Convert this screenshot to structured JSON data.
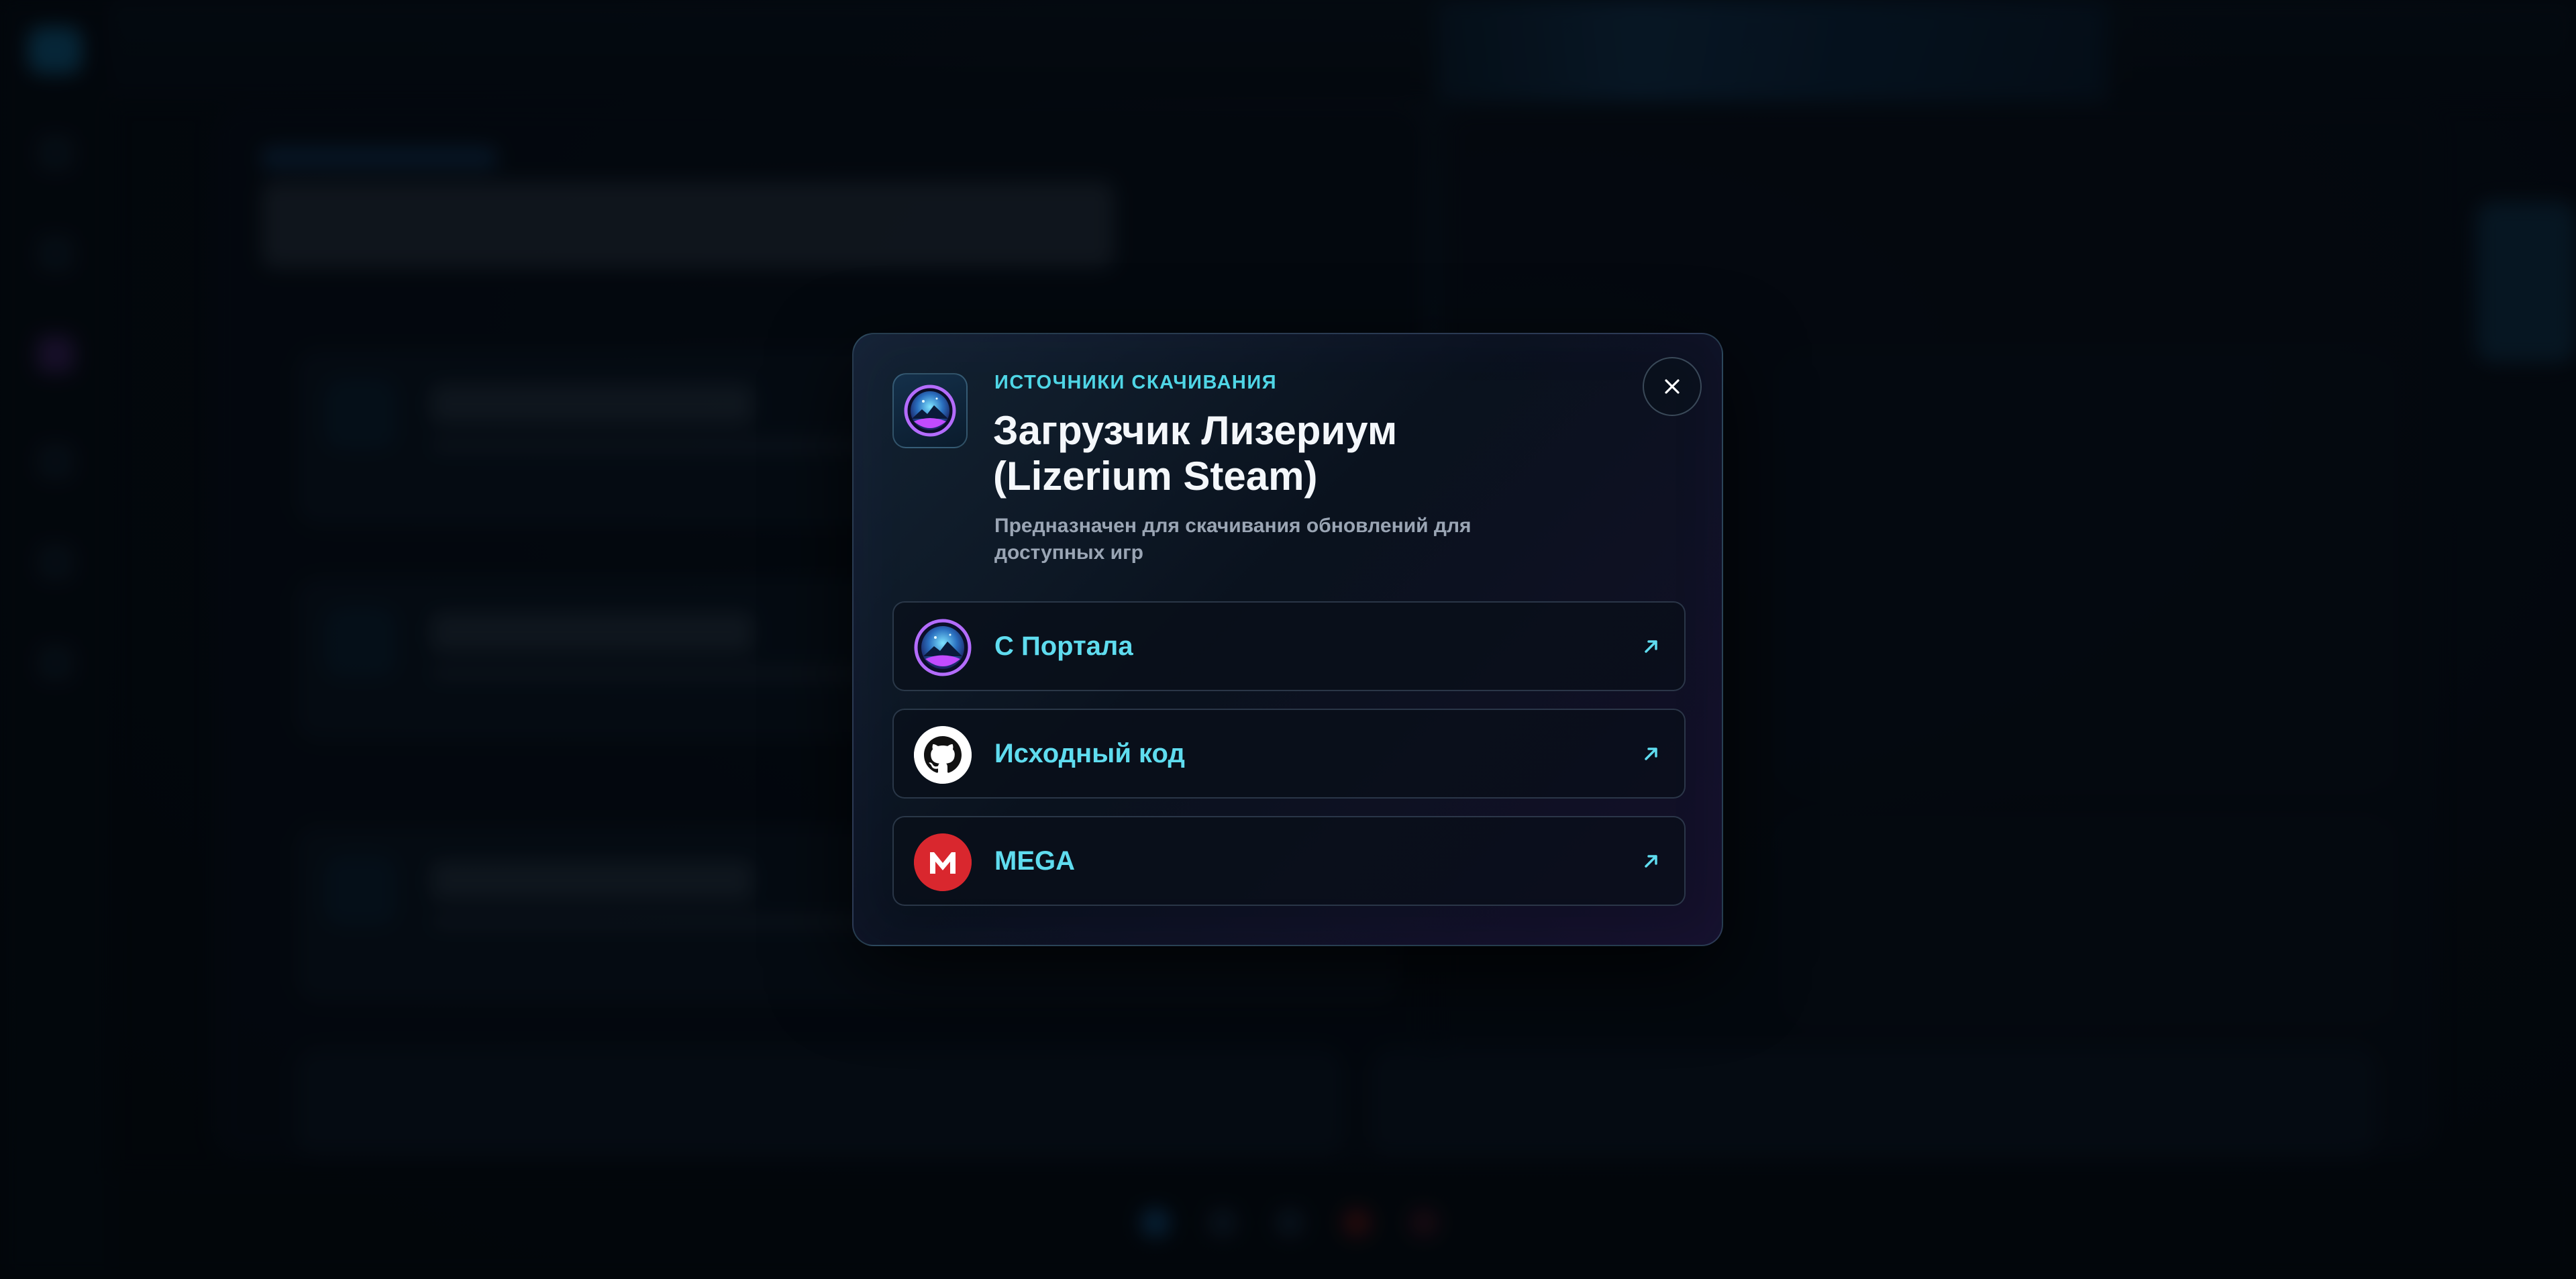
{
  "modal": {
    "eyebrow": "ИСТОЧНИКИ СКАЧИВАНИЯ",
    "title": "Загрузчик Лизериум (Lizerium Steam)",
    "description": "Предназначен для скачивания обновлений для доступных игр",
    "close_icon": "close-icon",
    "logo_icon": "lizerium-logo-icon"
  },
  "links": [
    {
      "label": "С Портала",
      "icon": "lizerium-logo-icon",
      "arrow": "external-link-arrow-icon"
    },
    {
      "label": "Исходный код",
      "icon": "github-icon",
      "arrow": "external-link-arrow-icon"
    },
    {
      "label": "MEGA",
      "icon": "mega-icon",
      "arrow": "external-link-arrow-icon"
    }
  ],
  "colors": {
    "accent": "#5fdcef",
    "eyebrow": "#4fd6e6",
    "title": "#f4f7fb",
    "description": "#9aa5b4",
    "mega_red": "#d9272e",
    "github_bg": "#ffffff",
    "backdrop": "#04070d"
  }
}
